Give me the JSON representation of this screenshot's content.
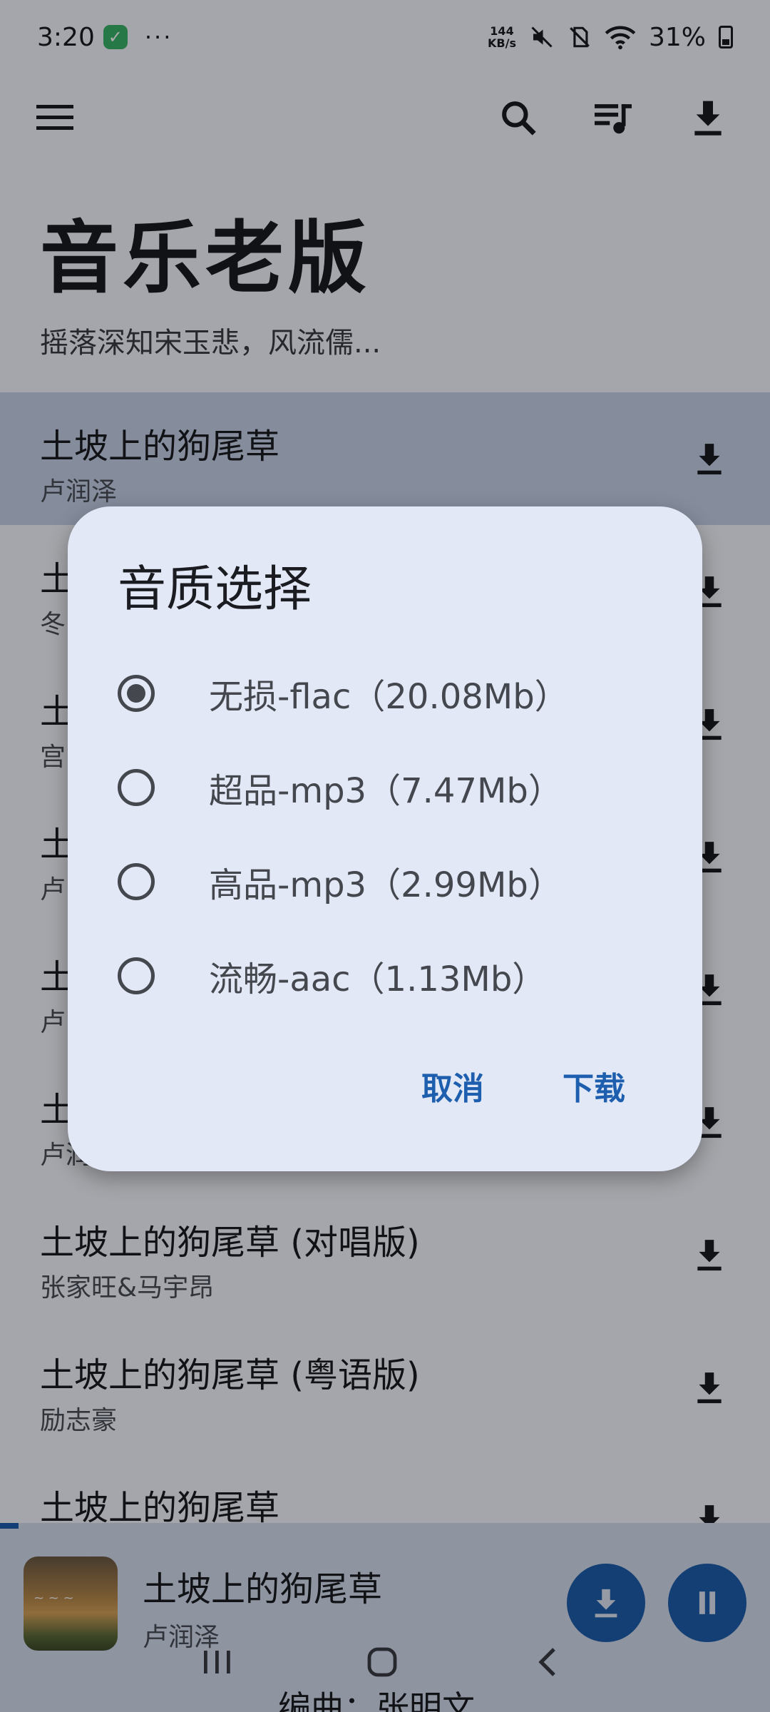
{
  "status_bar": {
    "time": "3:20",
    "net_speed_top": "144",
    "net_speed_bottom": "KB/s",
    "battery": "31%"
  },
  "header": {
    "title": "音乐老版",
    "subtitle": "摇落深知宋玉悲，风流儒..."
  },
  "songs": [
    {
      "title": "土坡上的狗尾草",
      "artist": "卢润泽"
    },
    {
      "title": "土",
      "artist": "冬"
    },
    {
      "title": "土",
      "artist": "宫"
    },
    {
      "title": "土",
      "artist": "卢"
    },
    {
      "title": "土",
      "artist": "卢"
    },
    {
      "title": "土",
      "artist": "卢润"
    },
    {
      "title": "土坡上的狗尾草 (对唱版)",
      "artist": "张家旺&马宇昂"
    },
    {
      "title": "土坡上的狗尾草 (粤语版)",
      "artist": "励志豪"
    },
    {
      "title": "土坡上的狗尾草",
      "artist": ""
    }
  ],
  "player": {
    "title": "土坡上的狗尾草",
    "artist": "卢润泽",
    "lyric": "编曲：张明文",
    "progress": 0.024
  },
  "dialog": {
    "title": "音质选择",
    "options": [
      {
        "label": "无损-flac（20.08Mb）",
        "selected": true
      },
      {
        "label": "超品-mp3（7.47Mb）",
        "selected": false
      },
      {
        "label": "高品-mp3（2.99Mb）",
        "selected": false
      },
      {
        "label": "流畅-aac（1.13Mb）",
        "selected": false
      }
    ],
    "cancel_label": "取消",
    "confirm_label": "下载"
  },
  "colors": {
    "accent": "#1d5fae",
    "dialog_bg": "#e2e8f6",
    "active_row": "#c7d2ea"
  }
}
